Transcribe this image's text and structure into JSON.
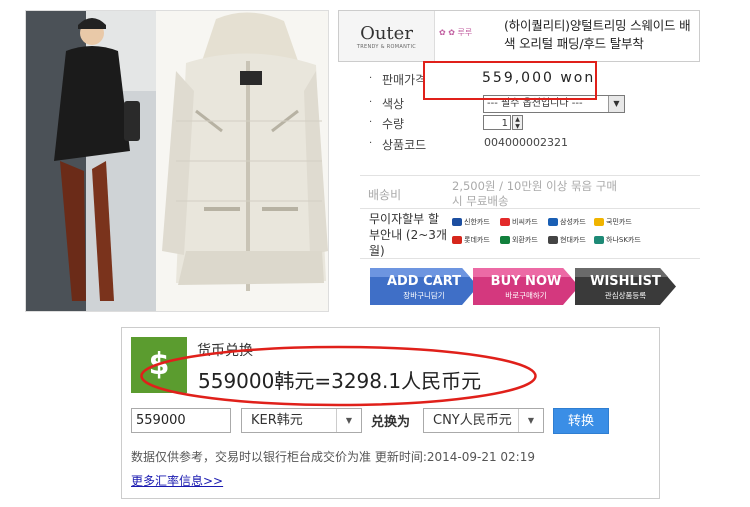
{
  "brand": {
    "name": "Outer",
    "tagline": "TRENDY & ROMANTIC",
    "mark": "✿ ✿ 루루"
  },
  "product": {
    "title": "(하이퀄리티)양털트리밍 스웨이드 배색 오리털 패딩/후드 탈부착",
    "price_label": "판매가격",
    "price_value": "559,000 won",
    "color_label": "색상",
    "color_select": "--- 필수 옵션입니다 ---",
    "qty_label": "수량",
    "qty_value": "1",
    "code_label": "상품코드",
    "code_value": "004000002321",
    "shipping_label": "배송비",
    "shipping_value": "2,500원 / 10만원 이상 묶음 구매시 무료배송",
    "installment_label": "무이자할부 할부안내 (2~3개월)",
    "cards": [
      {
        "label": "신한카드",
        "color": "#1c4ea0"
      },
      {
        "label": "비씨카드",
        "color": "#e32a2a"
      },
      {
        "label": "삼성카드",
        "color": "#1a5fb4"
      },
      {
        "label": "국민카드",
        "color": "#f0b400"
      },
      {
        "label": "롯데카드",
        "color": "#d6261c"
      },
      {
        "label": "외환카드",
        "color": "#12803c"
      },
      {
        "label": "현대카드",
        "color": "#444444"
      },
      {
        "label": "하나SK카드",
        "color": "#1e8a76"
      }
    ]
  },
  "buttons": {
    "add_cart": "ADD CART",
    "add_cart_sub": "장바구니담기",
    "buy_now": "BUY NOW",
    "buy_now_sub": "바로구매하기",
    "wishlist": "WISHLIST",
    "wishlist_sub": "관심상품등록"
  },
  "converter": {
    "title": "货币兑换",
    "result": "559000韩元=3298.1人民币元",
    "amount": "559000",
    "from_currency": "KER韩元",
    "convert_to_label": "兑换为",
    "to_currency": "CNY人民币元",
    "convert_button": "转换",
    "disclaimer": "数据仅供参考，交易时以银行柜台成交价为准 更新时间:2014-09-21 02:19",
    "more_link": "更多汇率信息>>"
  },
  "colors": {
    "annotation": "#e0201a",
    "currency_icon": "#5b9c2f",
    "convert_button": "#3a8ee6"
  }
}
